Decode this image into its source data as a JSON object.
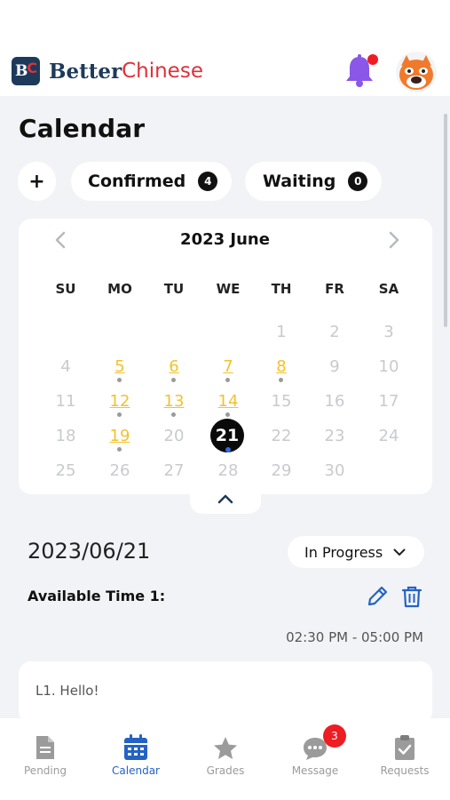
{
  "header": {
    "logo_initial": "B",
    "logo_accent": "C",
    "brand_first": "Better",
    "brand_second": "Chinese",
    "notification_icon": "bell-icon",
    "has_notification": true
  },
  "page": {
    "title": "Calendar"
  },
  "filters": {
    "add_label": "+",
    "confirmed_label": "Confirmed",
    "confirmed_count": "4",
    "waiting_label": "Waiting",
    "waiting_count": "0"
  },
  "calendar": {
    "month_label": "2023 June",
    "weekdays": [
      "SU",
      "MO",
      "TU",
      "WE",
      "TH",
      "FR",
      "SA"
    ],
    "selected_day": "21",
    "available_days": [
      "5",
      "6",
      "7",
      "8",
      "12",
      "13",
      "14",
      "19"
    ],
    "weeks": [
      [
        "",
        "",
        "",
        "",
        "1",
        "2",
        "3"
      ],
      [
        "4",
        "5",
        "6",
        "7",
        "8",
        "9",
        "10"
      ],
      [
        "11",
        "12",
        "13",
        "14",
        "15",
        "16",
        "17"
      ],
      [
        "18",
        "19",
        "20",
        "21",
        "22",
        "23",
        "24"
      ],
      [
        "25",
        "26",
        "27",
        "28",
        "29",
        "30",
        ""
      ]
    ],
    "accent_color": "#f2c22c"
  },
  "detail": {
    "date": "2023/06/21",
    "status": "In Progress",
    "available_time_label": "Available Time 1:",
    "time_range": "02:30 PM - 05:00 PM",
    "lesson": "L1. Hello!"
  },
  "bottom_nav": {
    "items": [
      {
        "label": "Pending",
        "icon": "document-icon"
      },
      {
        "label": "Calendar",
        "icon": "calendar-icon"
      },
      {
        "label": "Grades",
        "icon": "star-icon"
      },
      {
        "label": "Message",
        "icon": "chat-icon"
      },
      {
        "label": "Requests",
        "icon": "clipboard-check-icon"
      }
    ],
    "message_badge": "3",
    "active_color": "#2463c4"
  }
}
